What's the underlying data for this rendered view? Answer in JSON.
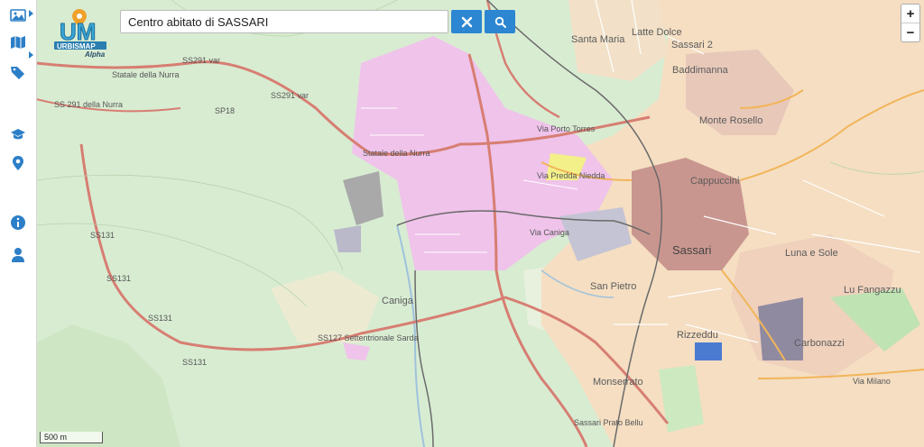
{
  "search": {
    "value": "Centro abitato di SASSARI"
  },
  "zoom": {
    "in_label": "+",
    "out_label": "−"
  },
  "scale": {
    "label": "500 m"
  },
  "logo": {
    "main": "UM",
    "text": "URBISMAP",
    "sub": "Alpha"
  },
  "sidebar": {
    "items": [
      {
        "icon": "image-icon"
      },
      {
        "icon": "map-icon"
      },
      {
        "icon": "tag-icon"
      },
      {
        "icon": "graduation-cap-icon"
      },
      {
        "icon": "map-marker-icon"
      },
      {
        "icon": "info-icon"
      },
      {
        "icon": "user-icon"
      }
    ]
  },
  "colors": {
    "accent": "#2c86d1",
    "industrial": "#efc3ea",
    "urban": "#f5dec2",
    "center": "#c9968f",
    "green": "#d8ecd2"
  },
  "map_labels": {
    "sassari": "Sassari",
    "cappuccini": "Cappuccini",
    "luna_sole": "Luna e Sole",
    "carbonazzi": "Carbonazzi",
    "san_pietro": "San Pietro",
    "monserrato": "Monserrato",
    "rizzeddu": "Rizzeddu",
    "monte_rosello": "Monte Rosello",
    "baddimanna": "Baddimanna",
    "santa_maria": "Santa Maria",
    "lu_fangazzu": "Lu Fangazzu",
    "caniga": "Caniga",
    "latte_dolce": "Latte Dolce",
    "sassari2": "Sassari 2",
    "ss291var": "SS291 var",
    "ss291var2": "SS291 var",
    "ss291": "SS 291 della Nurra",
    "statale_nurra": "Statale della Nurra",
    "statale_nurra2": "Statale della Nurra",
    "sp18": "SP18",
    "ss131": "SS131",
    "ss131b": "SS131",
    "ss131c": "SS131",
    "ss131d": "SS131",
    "ss127": "SS127 Settentrionale Sarda",
    "sassari_prato": "Sassari Prato Bellu",
    "via_milano": "Via Milano",
    "via_porto_torres": "Via Porto Torres",
    "via_predda": "Via Predda Niedda",
    "via_caniga": "Via Caniga"
  }
}
